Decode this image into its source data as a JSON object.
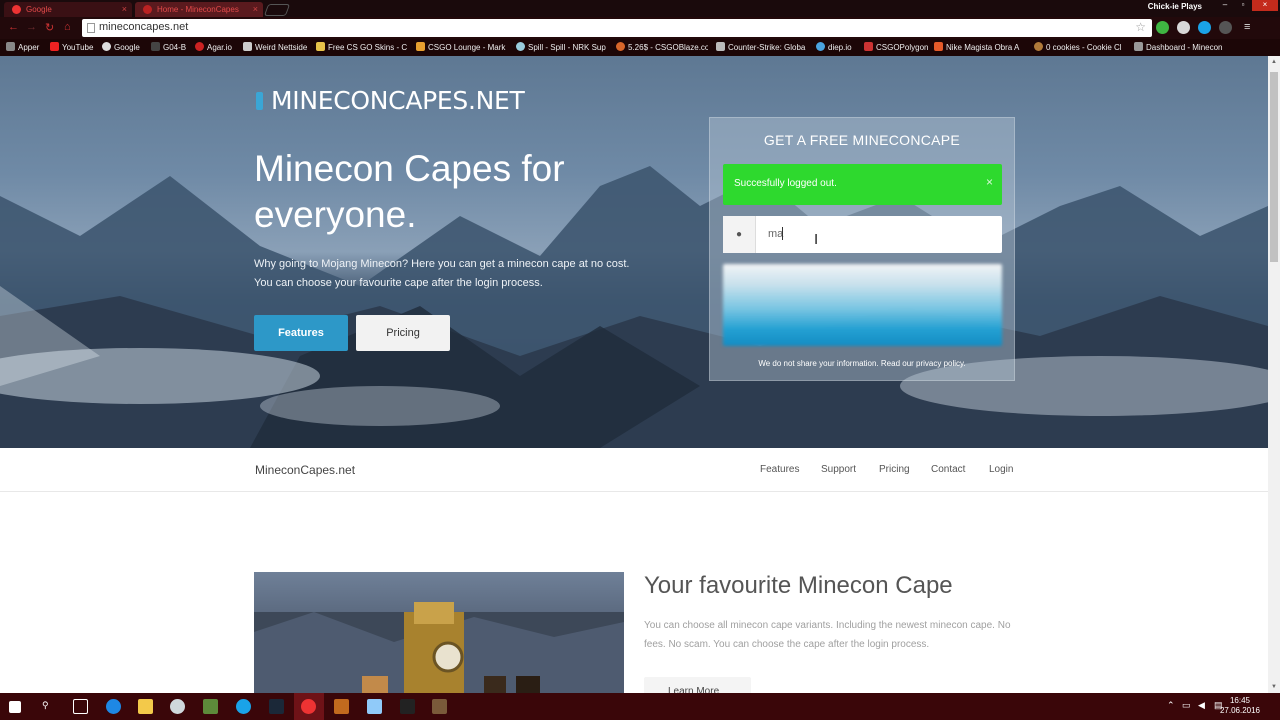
{
  "browser": {
    "tabs": [
      {
        "title": "Google",
        "active": false
      },
      {
        "title": "Home - MineconCapes",
        "active": true
      }
    ],
    "profile_name": "Chick-ie Plays",
    "address": "mineconcapes.net",
    "bookmarks": [
      {
        "label": "Apper",
        "icon": "apps-icon"
      },
      {
        "label": "YouTube",
        "icon": "youtube-icon"
      },
      {
        "label": "Google",
        "icon": "google-icon"
      },
      {
        "label": "G04-B",
        "icon": "bookmark-icon"
      },
      {
        "label": "Agar.io",
        "icon": "agar-icon"
      },
      {
        "label": "Weird Nettside",
        "icon": "page-icon"
      },
      {
        "label": "Free CS GO Skins - C",
        "icon": "trophy-icon"
      },
      {
        "label": "CSGO Lounge - Mark",
        "icon": "lounge-icon"
      },
      {
        "label": "Spill - Spill - NRK Sup",
        "icon": "nrk-icon"
      },
      {
        "label": "5.26$ - CSGOBlaze.co",
        "icon": "blaze-icon"
      },
      {
        "label": "Counter-Strike: Globa",
        "icon": "csgo-icon"
      },
      {
        "label": "diep.io",
        "icon": "diep-icon"
      },
      {
        "label": "CSGOPolygon",
        "icon": "polygon-icon"
      },
      {
        "label": "Nike Magista Obra A",
        "icon": "nike-icon"
      },
      {
        "label": "0 cookies - Cookie Cl",
        "icon": "cookie-icon"
      },
      {
        "label": "Dashboard - Minecon",
        "icon": "dashboard-icon"
      }
    ]
  },
  "hero": {
    "brand": "MINECONCAPES.NET",
    "headline": "Minecon Capes for everyone.",
    "intro_line1": "Why going to Mojang Minecon? Here you can get a minecon cape at no cost.",
    "intro_line2": "You can choose your favourite cape after the login process.",
    "features_button": "Features",
    "pricing_button": "Pricing"
  },
  "panel": {
    "title": "GET A FREE MINECONCAPE",
    "alert_text": "Succesfully logged out.",
    "alert_close": "×",
    "username_value": "ma",
    "privacy_text": "We do not share your information. Read our privacy policy."
  },
  "sitenav": {
    "logo": "MineconCapes.net",
    "links": [
      "Features",
      "Support",
      "Pricing",
      "Contact",
      "Login"
    ]
  },
  "section": {
    "title": "Your favourite Minecon Cape",
    "text": "You can choose all minecon cape variants. Including the newest minecon cape. No fees. No scam. You can choose the cape after the login process.",
    "button": "Learn More"
  },
  "taskbar": {
    "time": "16:45",
    "date": "27.06.2016"
  },
  "colors": {
    "accent": "#2d98c8",
    "alert_green": "#2ed92e",
    "chrome_red": "#e34a4a",
    "taskbar": "#3a0609"
  }
}
